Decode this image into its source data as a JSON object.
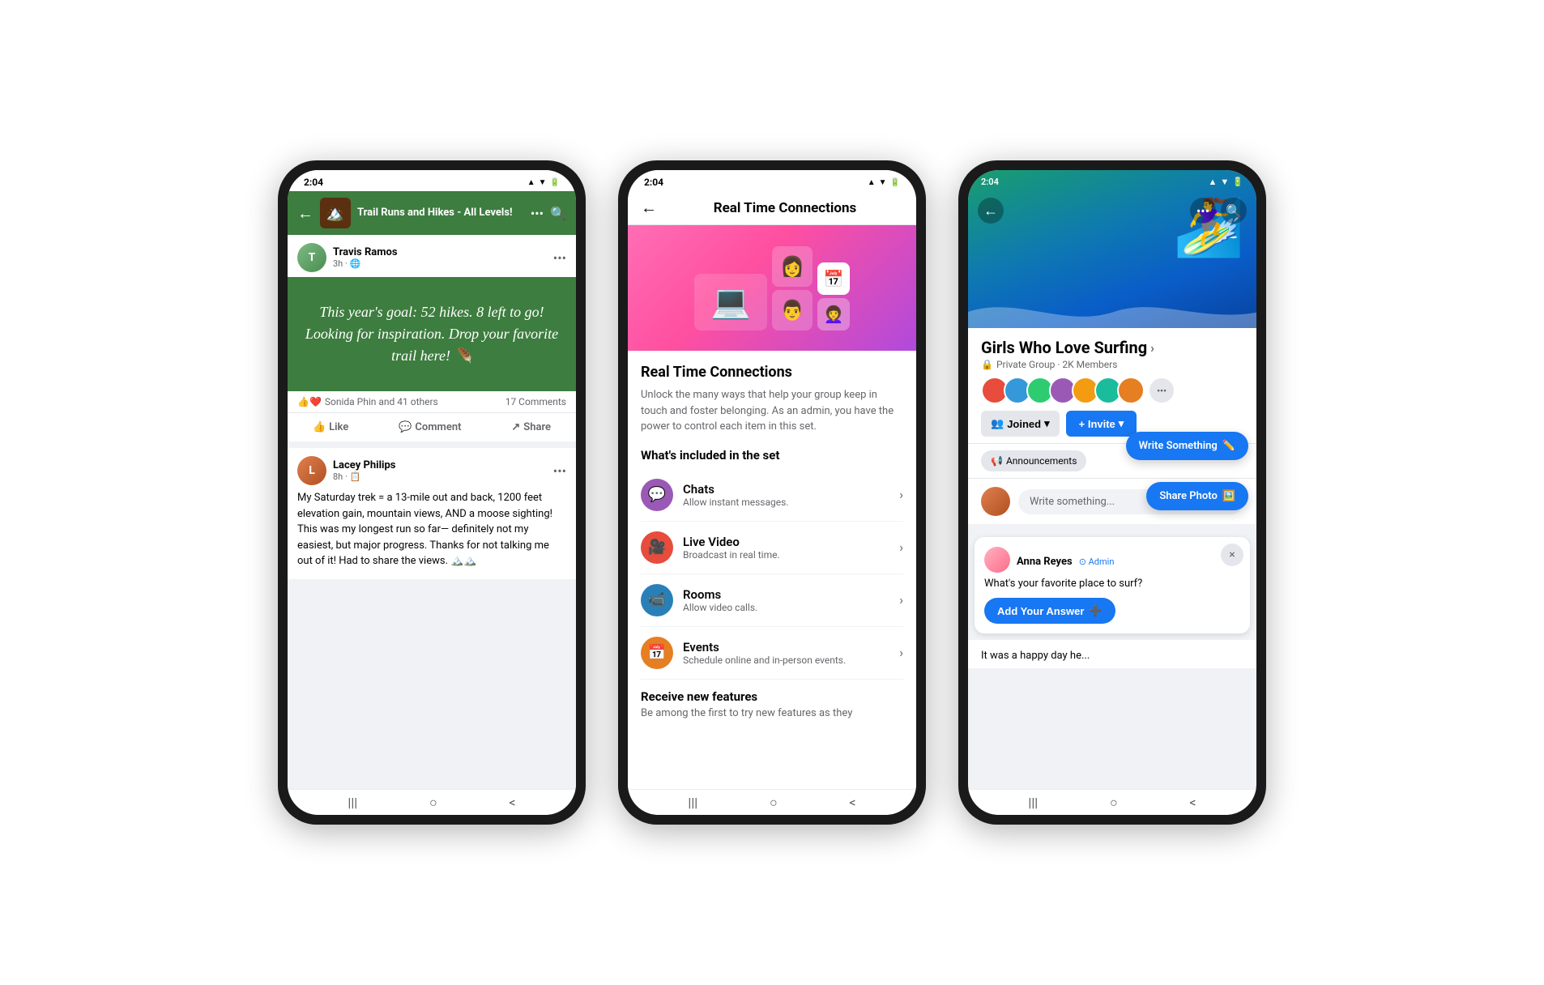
{
  "phone1": {
    "statusBar": {
      "time": "2:04"
    },
    "header": {
      "title": "Trail Runs and Hikes - All Levels!",
      "backLabel": "←",
      "dotsLabel": "•••",
      "searchLabel": "🔍"
    },
    "post1": {
      "author": "Travis Ramos",
      "time": "3h · 🌐",
      "dotsLabel": "•••",
      "content": "This year's goal: 52 hikes. 8 left to go! Looking for inspiration. Drop your favorite trail here! 🪶",
      "reactions": "Sonida Phin and 41 others",
      "comments": "17 Comments",
      "likeLabel": "Like",
      "commentLabel": "Comment",
      "shareLabel": "Share"
    },
    "post2": {
      "author": "Lacey Philips",
      "time": "8h · 📋",
      "dotsLabel": "•••",
      "content": "My Saturday trek = a 13-mile out and back, 1200 feet elevation gain, mountain views, AND a moose sighting! This was my longest run so far— definitely not my easiest, but major progress. Thanks for not talking me out of it! Had to share the views. 🏔️🏔️"
    },
    "navBar": {
      "menu": "|||",
      "home": "○",
      "back": "<"
    }
  },
  "phone2": {
    "statusBar": {
      "time": "2:04"
    },
    "header": {
      "title": "Real Time Connections",
      "backLabel": "←"
    },
    "featureTitle": "Real Time Connections",
    "featureDesc": "Unlock the many ways that help your group keep in touch and foster belonging. As an admin, you have the power to control each item in this set.",
    "sectionTitle": "What's included in the set",
    "items": [
      {
        "name": "Chats",
        "desc": "Allow instant messages.",
        "icon": "💬",
        "iconBg": "purple"
      },
      {
        "name": "Live Video",
        "desc": "Broadcast in real time.",
        "icon": "🎥",
        "iconBg": "red"
      },
      {
        "name": "Rooms",
        "desc": "Allow video calls.",
        "icon": "📹",
        "iconBg": "blue-dark"
      },
      {
        "name": "Events",
        "desc": "Schedule online and in-person events.",
        "icon": "📅",
        "iconBg": "orange-red"
      }
    ],
    "receiveTitle": "Receive new features",
    "receiveDesc": "Be among the first to try new features as they",
    "navBar": {
      "menu": "|||",
      "home": "○",
      "back": "<"
    }
  },
  "phone3": {
    "statusBar": {
      "time": ""
    },
    "header": {
      "backLabel": "←",
      "dotsLabel": "•••",
      "searchLabel": "🔍"
    },
    "groupName": "Girls Who Love Surfing",
    "groupMeta": "Private Group · 2K Members",
    "joinedLabel": "Joined",
    "inviteLabel": "+ Invite",
    "announcementsLabel": "Announcements",
    "writePlaceholder": "Write something...",
    "tooltipWrite": "Write Something",
    "tooltipShare": "Share Photo",
    "qa": {
      "name": "Anna Reyes",
      "adminLabel": "⊙ Admin",
      "question": "What's your favorite place to surf?",
      "addAnswerLabel": "Add Your Answer",
      "closeLabel": "×"
    },
    "feedText": "It was a happy day he...",
    "navBar": {
      "menu": "|||",
      "home": "○",
      "back": "<"
    }
  }
}
